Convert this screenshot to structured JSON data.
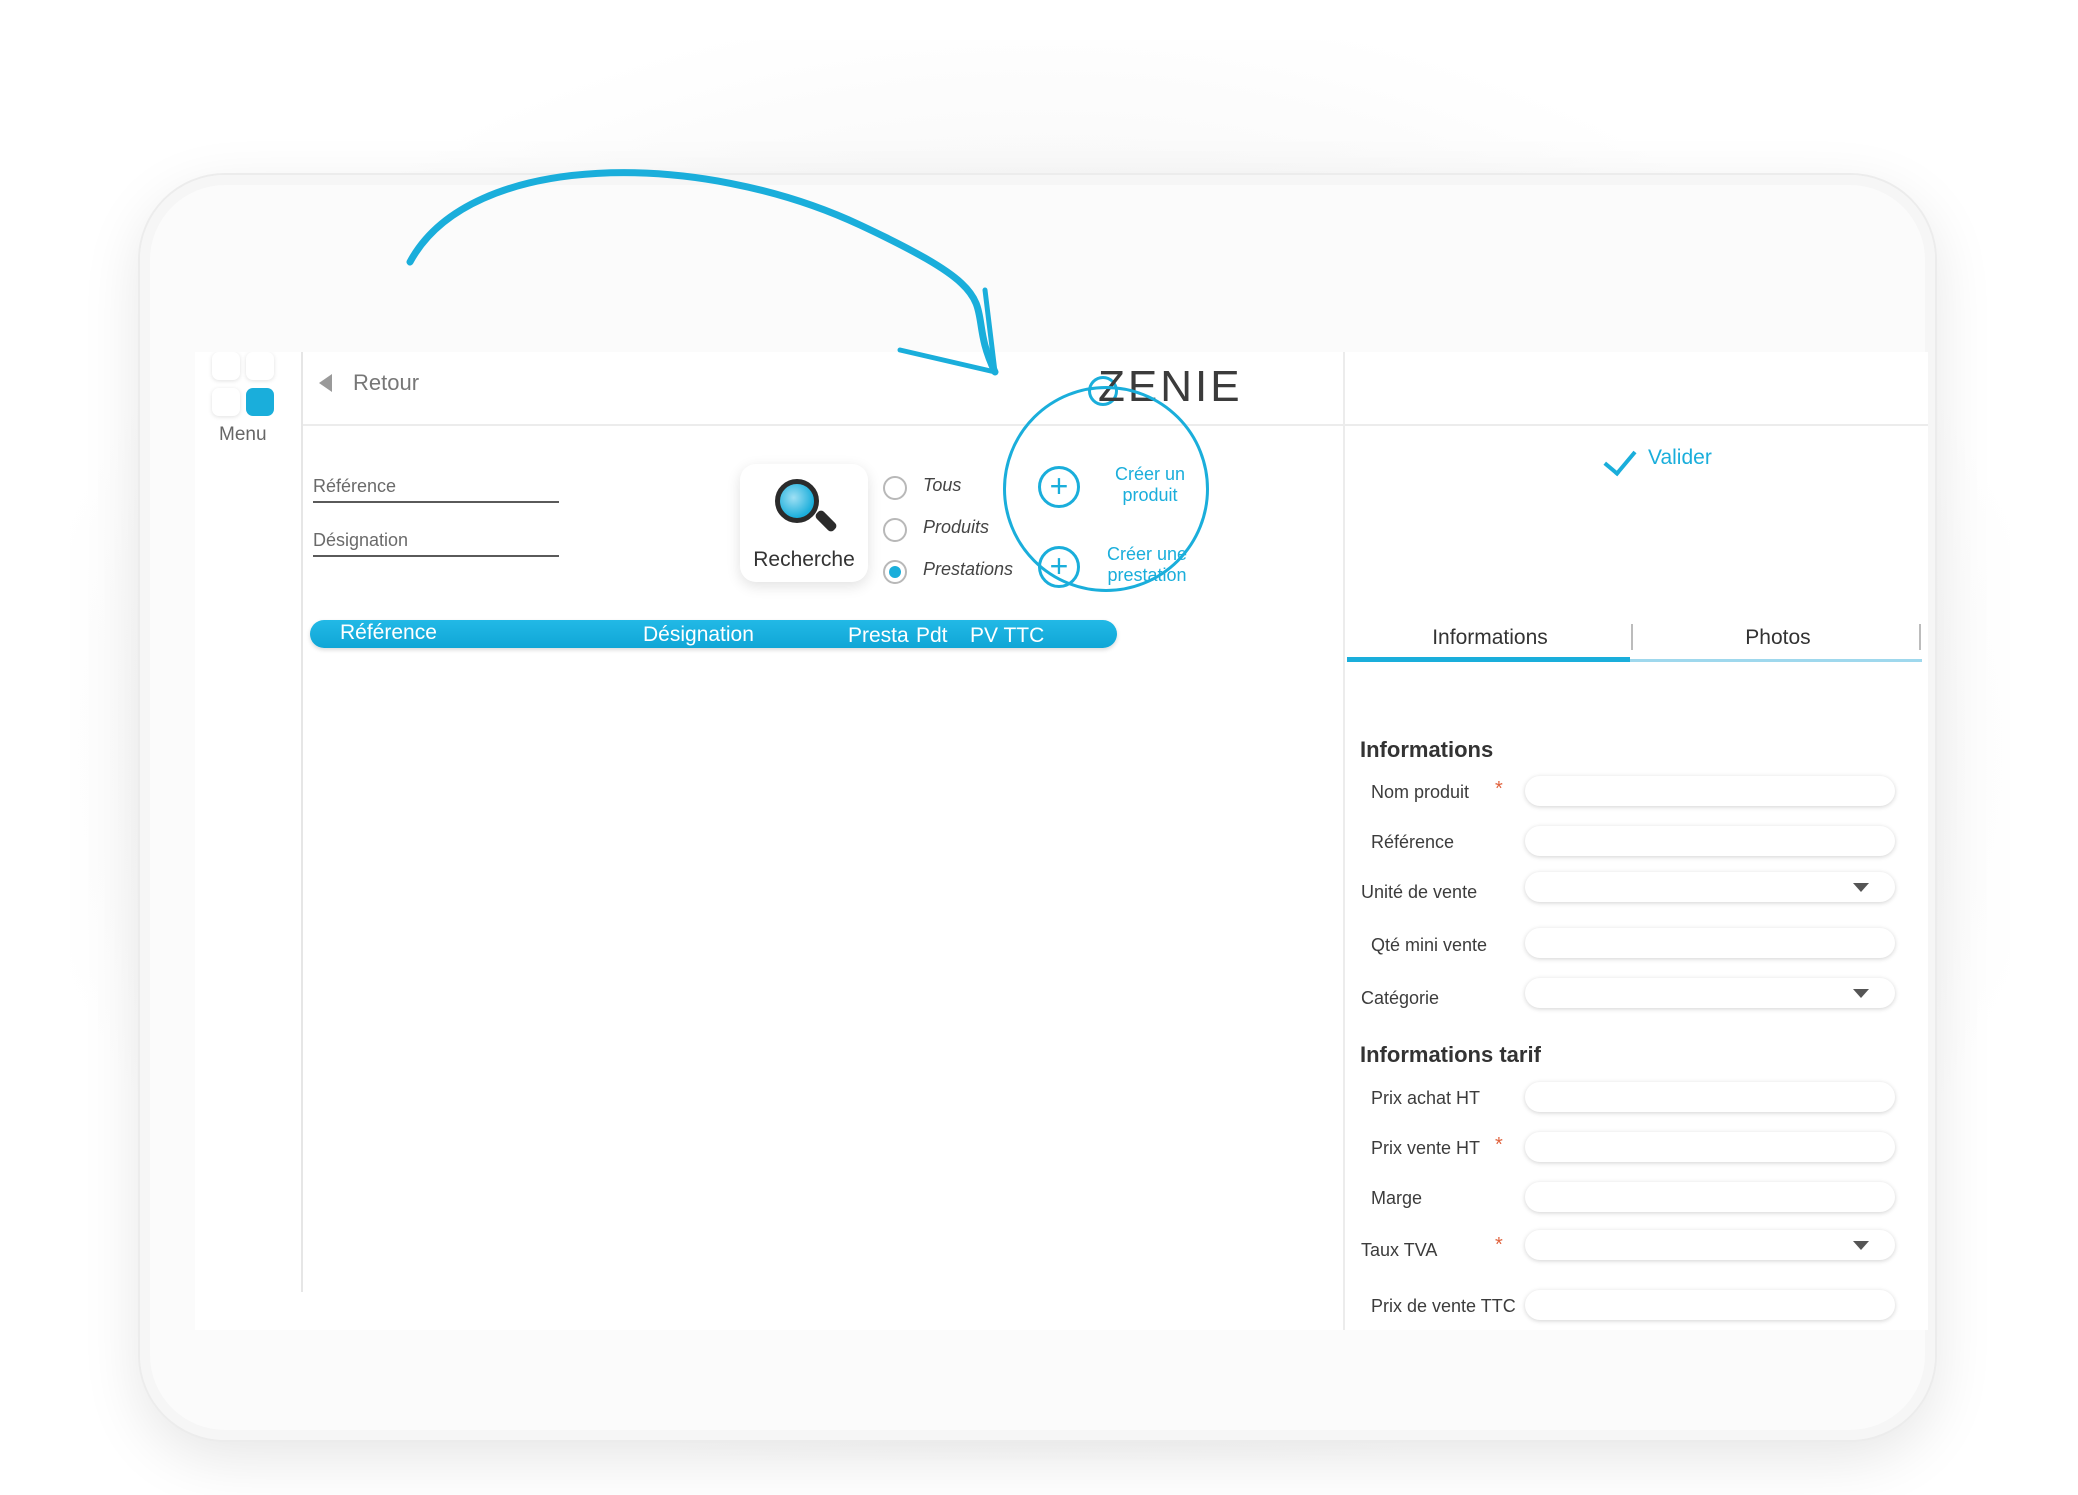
{
  "nav": {
    "menu_label": "Menu",
    "back_label": "Retour"
  },
  "brand": {
    "logo_text": "ZENIE"
  },
  "search": {
    "reference_label": "Référence",
    "designation_label": "Désignation",
    "button_label": "Recherche",
    "filters": [
      {
        "label": "Tous",
        "selected": false
      },
      {
        "label": "Produits",
        "selected": false
      },
      {
        "label": "Prestations",
        "selected": true
      }
    ]
  },
  "actions": {
    "create_product": [
      "Créer un",
      "produit"
    ],
    "create_service": [
      "Créer une",
      "prestation"
    ]
  },
  "table": {
    "columns": [
      "Référence",
      "Désignation",
      "Presta",
      "Pdt",
      "PV TTC"
    ]
  },
  "detail": {
    "validate_label": "Valider",
    "tabs": [
      "Informations",
      "Photos"
    ],
    "section_info": "Informations",
    "section_price": "Informations tarif",
    "fields_info": [
      {
        "label": "Nom produit",
        "required": "*"
      },
      {
        "label": "Référence",
        "required": ""
      },
      {
        "label": "Unité de vente",
        "required": ""
      },
      {
        "label": "Qté mini vente",
        "required": ""
      },
      {
        "label": "Catégorie",
        "required": ""
      }
    ],
    "fields_price": [
      {
        "label": "Prix achat HT",
        "required": ""
      },
      {
        "label": "Prix vente HT",
        "required": "*"
      },
      {
        "label": "Marge",
        "required": ""
      },
      {
        "label": "Taux TVA",
        "required": "*"
      },
      {
        "label": "Prix de vente TTC",
        "required": ""
      }
    ]
  },
  "colors": {
    "accent": "#1aaedb",
    "required": "#e0623d"
  }
}
